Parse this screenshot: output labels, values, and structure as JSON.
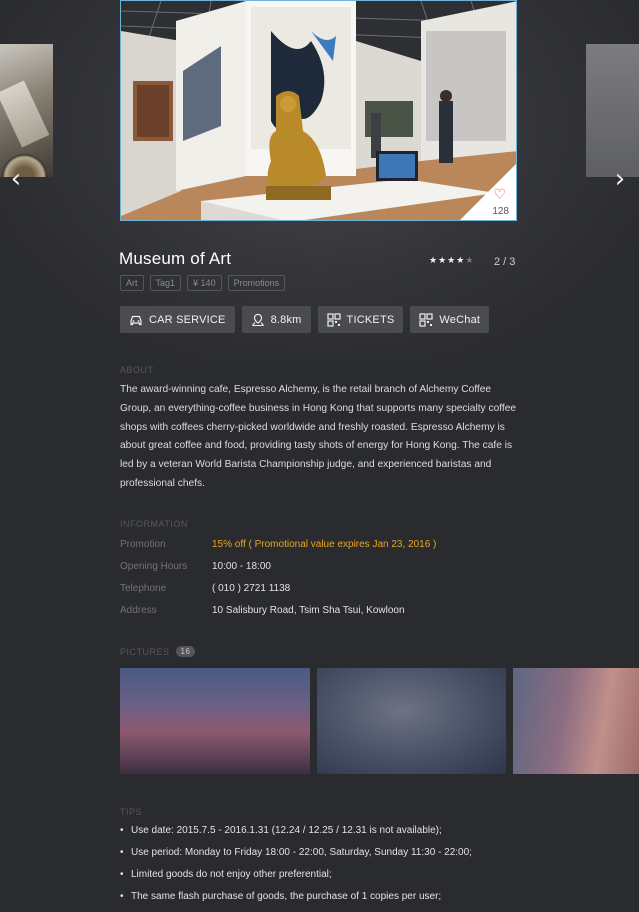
{
  "venue": {
    "title": "Museum of Art",
    "rating": 4,
    "rating_max": 5,
    "page": "2 / 3",
    "likes": "128",
    "tags": [
      "Art",
      "Tag1",
      "¥ 140",
      "Promotions"
    ]
  },
  "actions": [
    {
      "label": "CAR SERVICE",
      "icon": "car-icon"
    },
    {
      "label": "8.8km",
      "icon": "map-pin-icon"
    },
    {
      "label": "TICKETS",
      "icon": "qr-code-icon"
    },
    {
      "label": "WeChat",
      "icon": "qr-code-icon"
    }
  ],
  "about": {
    "heading": "ABOUT",
    "text": "The award-winning cafe, Espresso Alchemy, is the retail branch of Alchemy Coffee Group, an everything-coffee business in Hong Kong that supports many specialty coffee shops with coffees cherry-picked worldwide and freshly roasted. Espresso Alchemy is about great coffee and food, providing tasty shots of energy for Hong Kong. The cafe is led by a veteran World Barista Championship judge, and experienced baristas and professional chefs."
  },
  "information": {
    "heading": "INFORMATION",
    "rows": [
      {
        "label": "Promotion",
        "value": "15% off ( Promotional value expires Jan 23, 2016 )"
      },
      {
        "label": "Opening Hours",
        "value": "10:00 - 18:00"
      },
      {
        "label": "Telephone",
        "value": "( 010 ) 2721 1138"
      },
      {
        "label": "Address",
        "value": "10 Salisbury Road, Tsim Sha Tsui, Kowloon"
      }
    ]
  },
  "pictures": {
    "heading": "PICTURES",
    "count": "16"
  },
  "tips": {
    "heading": "TIPS",
    "items": [
      "Use date: 2015.7.5 - 2016.1.31 (12.24 / 12.25 / 12.31 is not available);",
      "Use period: Monday to Friday 18:00 - 22:00, Saturday, Sunday 11:30 - 22:00;",
      "Limited goods do not enjoy other preferential;",
      "The same flash purchase of goods, the purchase of 1 copies per user;"
    ]
  },
  "colors": {
    "background": "#2a2b2e",
    "button": "#4a4b4f",
    "promo": "#e9a521",
    "like": "#e23a3a",
    "hero_border": "#6fb3d8"
  }
}
